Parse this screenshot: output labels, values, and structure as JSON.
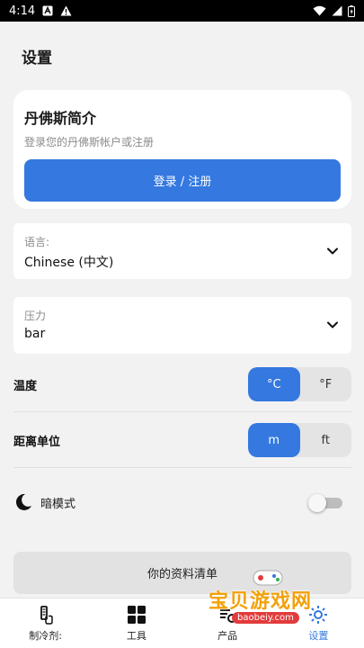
{
  "status_bar": {
    "time": "4:14"
  },
  "page": {
    "title": "设置"
  },
  "profile": {
    "title": "丹佛斯简介",
    "subtitle": "登录您的丹佛斯帐户或注册",
    "login_label": "登录 / 注册"
  },
  "language": {
    "label": "语言:",
    "value": "Chinese (中文)"
  },
  "pressure": {
    "label": "压力",
    "value": "bar"
  },
  "temperature": {
    "label": "温度",
    "options": [
      "°C",
      "°F"
    ],
    "selected": "°C"
  },
  "distance": {
    "label": "距离单位",
    "options": [
      "m",
      "ft"
    ],
    "selected": "m"
  },
  "dark_mode": {
    "label": "暗模式",
    "enabled": false
  },
  "data_list_button": "你的资料清单",
  "nav": {
    "items": [
      {
        "label": "制冷剂:",
        "icon": "refrigerant-icon"
      },
      {
        "label": "工具",
        "icon": "grid-icon"
      },
      {
        "label": "产品",
        "icon": "product-icon"
      },
      {
        "label": "设置",
        "icon": "settings-icon",
        "active": true
      }
    ]
  },
  "watermark": {
    "text": "宝贝游戏网",
    "url": "baobeiy.com"
  },
  "colors": {
    "accent": "#3478e0",
    "background": "#f2f2f2",
    "card": "#ffffff"
  }
}
